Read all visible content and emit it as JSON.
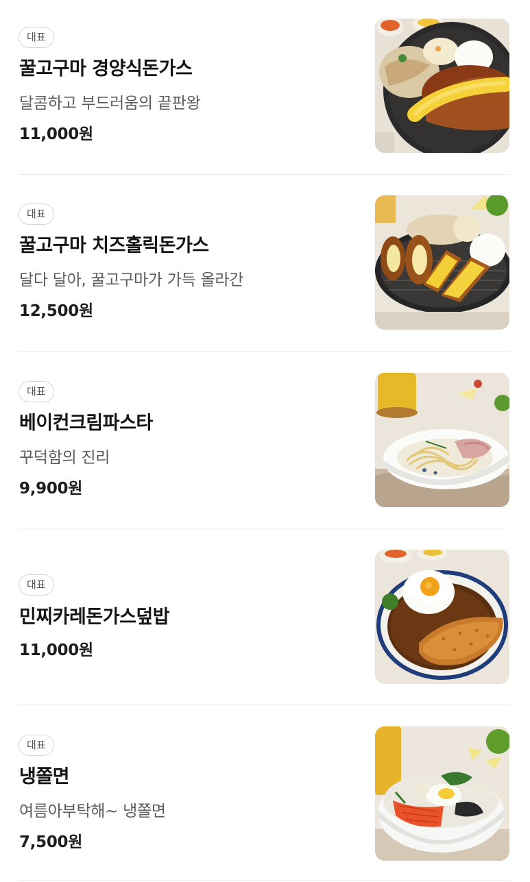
{
  "menu": {
    "items": [
      {
        "badge": "대표",
        "name": "꿀고구마 경양식돈가스",
        "description": "달콤하고 부드러움의 끝판왕",
        "price": "11,000원",
        "image_icon": "pork-cutlet-plate-image"
      },
      {
        "badge": "대표",
        "name": "꿀고구마 치즈홀릭돈가스",
        "description": "달다 달아, 꿀고구마가 가득 올라간",
        "price": "12,500원",
        "image_icon": "cheese-cutlet-grill-image"
      },
      {
        "badge": "대표",
        "name": "베이컨크림파스타",
        "description": "꾸덕함의 진리",
        "price": "9,900원",
        "image_icon": "cream-pasta-bowl-image"
      },
      {
        "badge": "대표",
        "name": "민찌카레돈가스덮밥",
        "description": "",
        "price": "11,000원",
        "image_icon": "curry-cutlet-rice-image"
      },
      {
        "badge": "대표",
        "name": "냉쫄면",
        "description": "여름아부탁해~ 냉쫄면",
        "price": "7,500원",
        "image_icon": "cold-noodle-bowl-image"
      }
    ]
  }
}
